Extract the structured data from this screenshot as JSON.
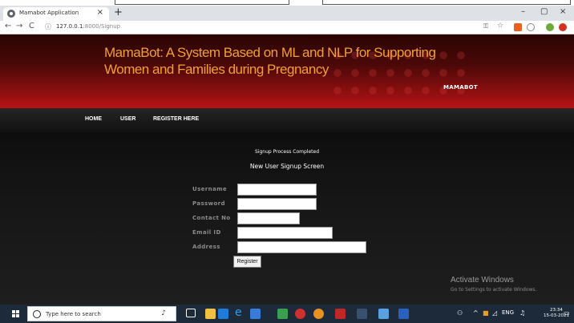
{
  "browser": {
    "tab_title": "Mamabot Application",
    "tab_close": "×",
    "new_tab": "+",
    "win_min": "–",
    "win_max": "▢",
    "win_close": "×",
    "back": "←",
    "forward": "→",
    "reload": "C",
    "info": "ⓘ",
    "url_host": "127.0.0.1",
    "url_path": ":8000/Signup"
  },
  "header": {
    "title": "MamaBot: A System Based on ML and NLP for Supporting Women and Families during Pregnancy",
    "tag": "MAMABOT"
  },
  "menu": {
    "items": [
      {
        "label": "HOME"
      },
      {
        "label": "USER"
      },
      {
        "label": "REGISTER HERE"
      }
    ]
  },
  "main": {
    "status": "Signup Process Completed",
    "form_title": "New User Signup Screen",
    "fields": [
      {
        "label": "Username",
        "value": ""
      },
      {
        "label": "Password",
        "value": ""
      },
      {
        "label": "Contact No",
        "value": ""
      },
      {
        "label": "Email ID",
        "value": ""
      },
      {
        "label": "Address",
        "value": ""
      }
    ],
    "register_label": "Register"
  },
  "watermark": {
    "title": "Activate Windows",
    "subtitle": "Go to Settings to activate Windows."
  },
  "taskbar": {
    "search_placeholder": "Type here to search",
    "time": "23:34",
    "date": "15-03-2021"
  },
  "colors": {
    "header_title": "#f0a030",
    "header_bg_top": "#2a0404",
    "header_bg_bottom": "#b81414",
    "main_bg": "#161616",
    "label": "#8a8a8a"
  }
}
